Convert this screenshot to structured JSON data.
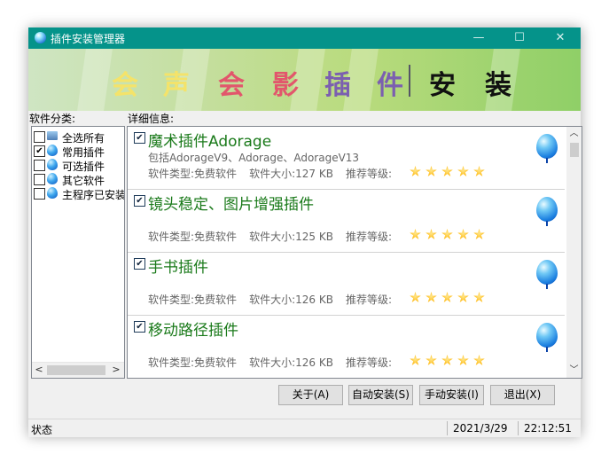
{
  "window": {
    "title": "插件安装管理器",
    "minimize": "—",
    "maximize": "☐",
    "close": "✕"
  },
  "banner": {
    "chars": [
      {
        "t": "会",
        "c": "#f4e36a"
      },
      {
        "t": "声",
        "c": "#f4e36a"
      },
      {
        "t": "会",
        "c": "#e2566c"
      },
      {
        "t": "影",
        "c": "#e2566c"
      },
      {
        "t": "插",
        "c": "#7b5fb0"
      },
      {
        "t": "件",
        "c": "#7b5fb0"
      },
      {
        "t": "安",
        "c": "#111111"
      },
      {
        "t": "装",
        "c": "#111111"
      }
    ]
  },
  "left": {
    "label": "软件分类:",
    "items": [
      {
        "label": "全选所有",
        "checked": false,
        "icon": "computer-icon"
      },
      {
        "label": "常用插件",
        "checked": true,
        "icon": "balloon-icon"
      },
      {
        "label": "可选插件",
        "checked": false,
        "icon": "balloon-icon"
      },
      {
        "label": "其它软件",
        "checked": false,
        "icon": "balloon-icon"
      },
      {
        "label": "主程序已安装",
        "checked": false,
        "icon": "balloon-icon"
      }
    ],
    "scroll_left": "<",
    "scroll_right": ">"
  },
  "right": {
    "label": "详细信息:",
    "scroll_up": "︿",
    "scroll_down": "﹀",
    "plugins": [
      {
        "name": "魔术插件Adorage",
        "desc": "包括AdorageV9、Adorage、AdorageV13",
        "type_label": "软件类型:",
        "type": "免费软件",
        "size_label": "软件大小:",
        "size": "127 KB",
        "rating_label": "推荐等级:",
        "rating": 5,
        "checked": true
      },
      {
        "name": "镜头稳定、图片增强插件",
        "desc": "",
        "type_label": "软件类型:",
        "type": "免费软件",
        "size_label": "软件大小:",
        "size": "125 KB",
        "rating_label": "推荐等级:",
        "rating": 5,
        "checked": true
      },
      {
        "name": "手书插件",
        "desc": "",
        "type_label": "软件类型:",
        "type": "免费软件",
        "size_label": "软件大小:",
        "size": "126 KB",
        "rating_label": "推荐等级:",
        "rating": 5,
        "checked": true
      },
      {
        "name": "移动路径插件",
        "desc": "",
        "type_label": "软件类型:",
        "type": "免费软件",
        "size_label": "软件大小:",
        "size": "126 KB",
        "rating_label": "推荐等级:",
        "rating": 5,
        "checked": true
      }
    ]
  },
  "buttons": {
    "about": "关于(A)",
    "auto_install": "自动安装(S)",
    "manual_install": "手动安装(I)",
    "exit": "退出(X)"
  },
  "status": {
    "text": "状态",
    "date": "2021/3/29",
    "time": "22:12:51"
  }
}
